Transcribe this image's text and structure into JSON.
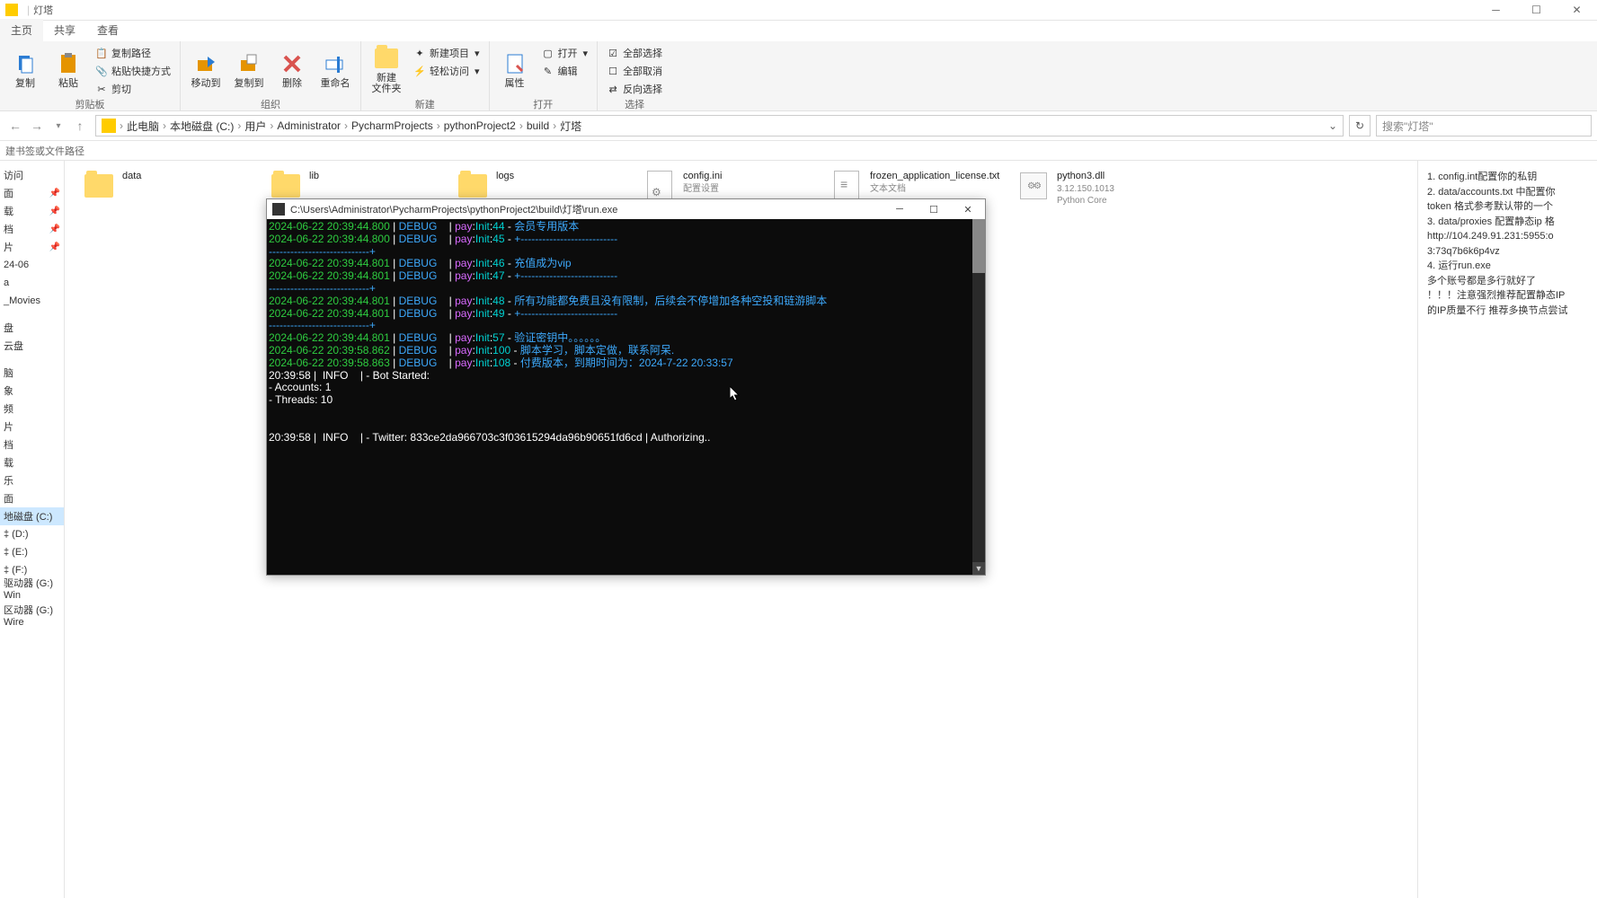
{
  "window": {
    "title": "灯塔"
  },
  "menutabs": {
    "main": "主页",
    "share": "共享",
    "view": "查看"
  },
  "ribbon": {
    "clipboard": {
      "copy": "复制",
      "paste": "粘贴",
      "copyPath": "复制路径",
      "pasteShortcut": "粘贴快捷方式",
      "cut": "剪切",
      "label": "剪贴板"
    },
    "organize": {
      "moveTo": "移动到",
      "copyTo": "复制到",
      "delete": "删除",
      "rename": "重命名",
      "label": "组织"
    },
    "new": {
      "newFolder": "新建\n文件夹",
      "newItem": "新建项目",
      "easyAccess": "轻松访问",
      "label": "新建"
    },
    "open": {
      "properties": "属性",
      "open": "打开",
      "edit": "编辑",
      "label": "打开"
    },
    "select": {
      "selectAll": "全部选择",
      "selectNone": "全部取消",
      "invert": "反向选择",
      "label": "选择"
    }
  },
  "breadcrumb": {
    "segs": [
      "此电脑",
      "本地磁盘 (C:)",
      "用户",
      "Administrator",
      "PycharmProjects",
      "pythonProject2",
      "build",
      "灯塔"
    ]
  },
  "search": {
    "placeholder": "搜索\"灯塔\""
  },
  "bookmarkBar": "建书签或文件路径",
  "sidebar": {
    "quick": "访问",
    "pinned": [
      "面",
      "载",
      "档",
      "片"
    ],
    "recent1": "24-06",
    "recent2": "a",
    "movies": "_Movies",
    "disk": "盘",
    "cloud": "云盘",
    "thispc": "脑",
    "items2": [
      "象",
      "频",
      "片",
      "档",
      "载",
      "乐",
      "面"
    ],
    "driveC": "地磁盘 (C:)",
    "driveD": "‡ (D:)",
    "driveE": "‡ (E:)",
    "driveF": "‡ (F:)",
    "driveG1": "驱动器 (G:) Win",
    "driveG2": "区动器 (G:) Wire"
  },
  "files": {
    "data": {
      "name": "data"
    },
    "lib": {
      "name": "lib"
    },
    "logs": {
      "name": "logs"
    },
    "config": {
      "name": "config.ini",
      "meta": "配置设置"
    },
    "license": {
      "name": "frozen_application_license.txt",
      "meta": "文本文档"
    },
    "dll": {
      "name": "python3.dll",
      "ver": "3.12.150.1013",
      "meta": "Python Core"
    }
  },
  "details": {
    "lines": [
      "1. config.int配置你的私钥",
      "2. data/accounts.txt 中配置你",
      "token  格式参考默认带的一个",
      "3. data/proxies 配置静态ip 格",
      "http://104.249.91.231:5955:o",
      "3:73q7b6k6p4vz",
      "4. 运行run.exe",
      "多个账号都是多行就好了",
      "",
      "！！！注意强烈推荐配置静态IP",
      "的IP质量不行 推荐多换节点尝试"
    ]
  },
  "terminal": {
    "title": "C:\\Users\\Administrator\\PycharmProjects\\pythonProject2\\build\\灯塔\\run.exe",
    "lines": [
      {
        "ts": "2024-06-22 20:39:44.800",
        "lvl": "DEBUG",
        "loc": "pay:Init:44",
        "msg": "会员专用版本"
      },
      {
        "ts": "2024-06-22 20:39:44.800",
        "lvl": "DEBUG",
        "loc": "pay:Init:45",
        "msg": "+---------------------------"
      },
      {
        "sep": "----------------------------+"
      },
      {
        "ts": "2024-06-22 20:39:44.801",
        "lvl": "DEBUG",
        "loc": "pay:Init:46",
        "msg": "充值成为vip"
      },
      {
        "ts": "2024-06-22 20:39:44.801",
        "lvl": "DEBUG",
        "loc": "pay:Init:47",
        "msg": "+---------------------------"
      },
      {
        "sep": "----------------------------+"
      },
      {
        "ts": "2024-06-22 20:39:44.801",
        "lvl": "DEBUG",
        "loc": "pay:Init:48",
        "msg": "所有功能都免费且没有限制，后续会不停增加各种空投和链游脚本"
      },
      {
        "ts": "2024-06-22 20:39:44.801",
        "lvl": "DEBUG",
        "loc": "pay:Init:49",
        "msg": "+---------------------------"
      },
      {
        "sep": "----------------------------+"
      },
      {
        "ts": "2024-06-22 20:39:44.801",
        "lvl": "DEBUG",
        "loc": "pay:Init:57",
        "msg": "验证密钥中。。。。。。"
      },
      {
        "ts": "2024-06-22 20:39:58.862",
        "lvl": "DEBUG",
        "loc": "pay:Init:100",
        "msg": "脚本学习，脚本定做，联系阿呆."
      },
      {
        "ts": "2024-06-22 20:39:58.863",
        "lvl": "DEBUG",
        "loc": "pay:Init:108",
        "msg": "付费版本，到期时间为：2024-7-22 20:33:57"
      }
    ],
    "infoLines": [
      "20:39:58 |  INFO    | - Bot Started:",
      "- Accounts: 1",
      "- Threads: 10",
      "",
      "",
      "20:39:58 |  INFO    | - Twitter: 833ce2da966703c3f03615294da96b90651fd6cd | Authorizing.."
    ]
  }
}
